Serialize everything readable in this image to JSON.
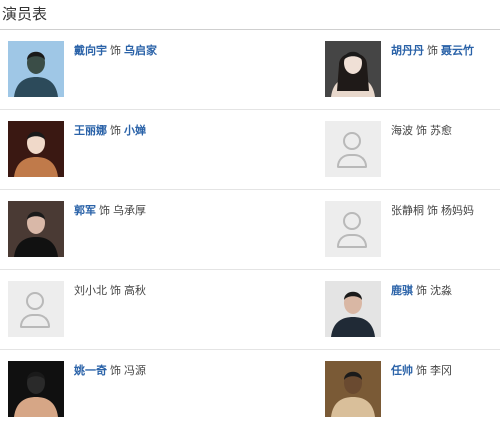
{
  "section": {
    "title": "演员表"
  },
  "rows": [
    [
      {
        "actor": "戴向宇",
        "sep": "饰",
        "role": "乌启家",
        "actor_link": true,
        "role_link": true,
        "photo": "suit-man",
        "colors": [
          "#9fc7e6",
          "#2c4a5a",
          "#3a4d47"
        ]
      },
      {
        "actor": "胡丹丹",
        "sep": "饰",
        "role": "聂云竹",
        "actor_link": true,
        "role_link": true,
        "photo": "long-hair-woman",
        "colors": [
          "#454545",
          "#e8d8cc",
          "#1f1a18"
        ]
      }
    ],
    [
      {
        "actor": "王丽娜",
        "sep": "饰",
        "role": "小婵",
        "actor_link": true,
        "role_link": true,
        "photo": "warm-portrait",
        "colors": [
          "#3a1812",
          "#c07a4a",
          "#f0d9c9"
        ]
      },
      {
        "actor": "海波",
        "sep": "饰",
        "role": "苏愈",
        "actor_link": false,
        "role_link": false,
        "photo": "placeholder",
        "colors": []
      }
    ],
    [
      {
        "actor": "郭军",
        "sep": "饰",
        "role": "乌承厚",
        "actor_link": true,
        "role_link": false,
        "photo": "dark-suit-man",
        "colors": [
          "#4a3a34",
          "#111111",
          "#d9b8a8"
        ]
      },
      {
        "actor": "张静桐",
        "sep": "饰",
        "role": "杨妈妈",
        "actor_link": false,
        "role_link": false,
        "photo": "placeholder",
        "colors": []
      }
    ],
    [
      {
        "actor": "刘小北",
        "sep": "饰",
        "role": "高秋",
        "actor_link": false,
        "role_link": false,
        "photo": "placeholder",
        "colors": []
      },
      {
        "actor": "鹿骐",
        "sep": "饰",
        "role": "沈淼",
        "actor_link": true,
        "role_link": false,
        "photo": "young-man",
        "colors": [
          "#e4e4e4",
          "#202a36",
          "#d9b7a4"
        ]
      }
    ],
    [
      {
        "actor": "姚一奇",
        "sep": "饰",
        "role": "冯源",
        "actor_link": true,
        "role_link": false,
        "photo": "smiling-man",
        "colors": [
          "#101010",
          "#d6a686",
          "#2a2a2a"
        ]
      },
      {
        "actor": "任帅",
        "sep": "饰",
        "role": "李冈",
        "actor_link": true,
        "role_link": false,
        "photo": "sweater-man",
        "colors": [
          "#7a5a36",
          "#d9bf9a",
          "#6a4a30"
        ]
      }
    ]
  ]
}
